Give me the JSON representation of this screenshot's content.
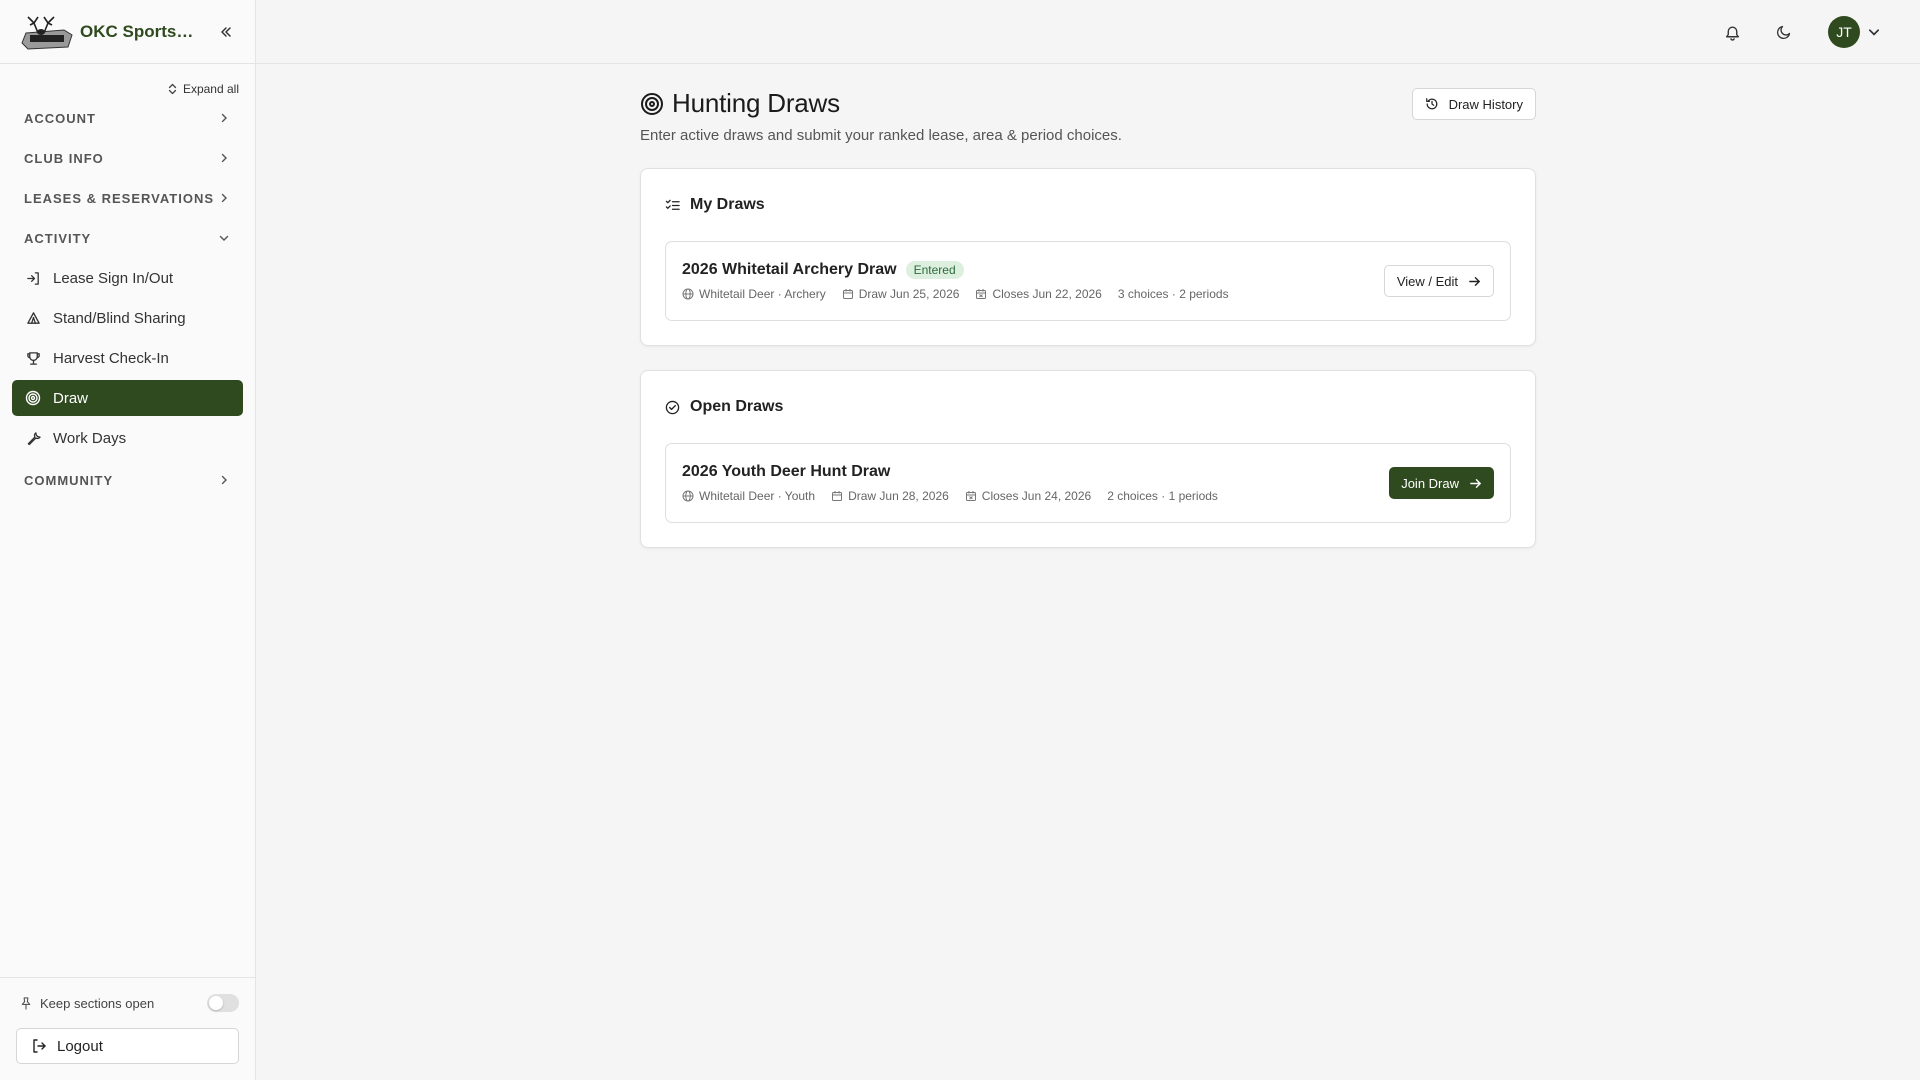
{
  "app": {
    "name": "OKC Sportsma..."
  },
  "sidebar": {
    "expand_all": "Expand all",
    "sections": {
      "account": "ACCOUNT",
      "club_info": "CLUB INFO",
      "leases": "LEASES & RESERVATIONS",
      "activity": "ACTIVITY",
      "community": "COMMUNITY"
    },
    "activity_items": [
      {
        "label": "Lease Sign In/Out",
        "icon": "sign-in-icon"
      },
      {
        "label": "Stand/Blind Sharing",
        "icon": "tent-icon"
      },
      {
        "label": "Harvest Check-In",
        "icon": "trophy-icon"
      },
      {
        "label": "Draw",
        "icon": "target-icon",
        "active": true
      },
      {
        "label": "Work Days",
        "icon": "wrench-icon"
      }
    ],
    "keep_sections_open": "Keep sections open",
    "logout": "Logout"
  },
  "topbar": {
    "user_initials": "JT"
  },
  "page": {
    "title": "Hunting Draws",
    "subtitle": "Enter active draws and submit your ranked lease, area & period choices.",
    "history_button": "Draw History"
  },
  "my_draws": {
    "title": "My Draws",
    "items": [
      {
        "name": "2026 Whitetail Archery Draw",
        "badge": "Entered",
        "species": "Whitetail Deer · Archery",
        "draw_date": "Draw Jun 25, 2026",
        "closes": "Closes Jun 22, 2026",
        "choices": "3 choices · 2 periods",
        "action": "View / Edit"
      }
    ]
  },
  "open_draws": {
    "title": "Open Draws",
    "items": [
      {
        "name": "2026 Youth Deer Hunt Draw",
        "species": "Whitetail Deer · Youth",
        "draw_date": "Draw Jun 28, 2026",
        "closes": "Closes Jun 24, 2026",
        "choices": "2 choices · 1 periods",
        "action": "Join Draw"
      }
    ]
  },
  "colors": {
    "brand": "#2f4a1f",
    "badge_bg": "#ddefdf",
    "badge_text": "#2e6a3b"
  }
}
